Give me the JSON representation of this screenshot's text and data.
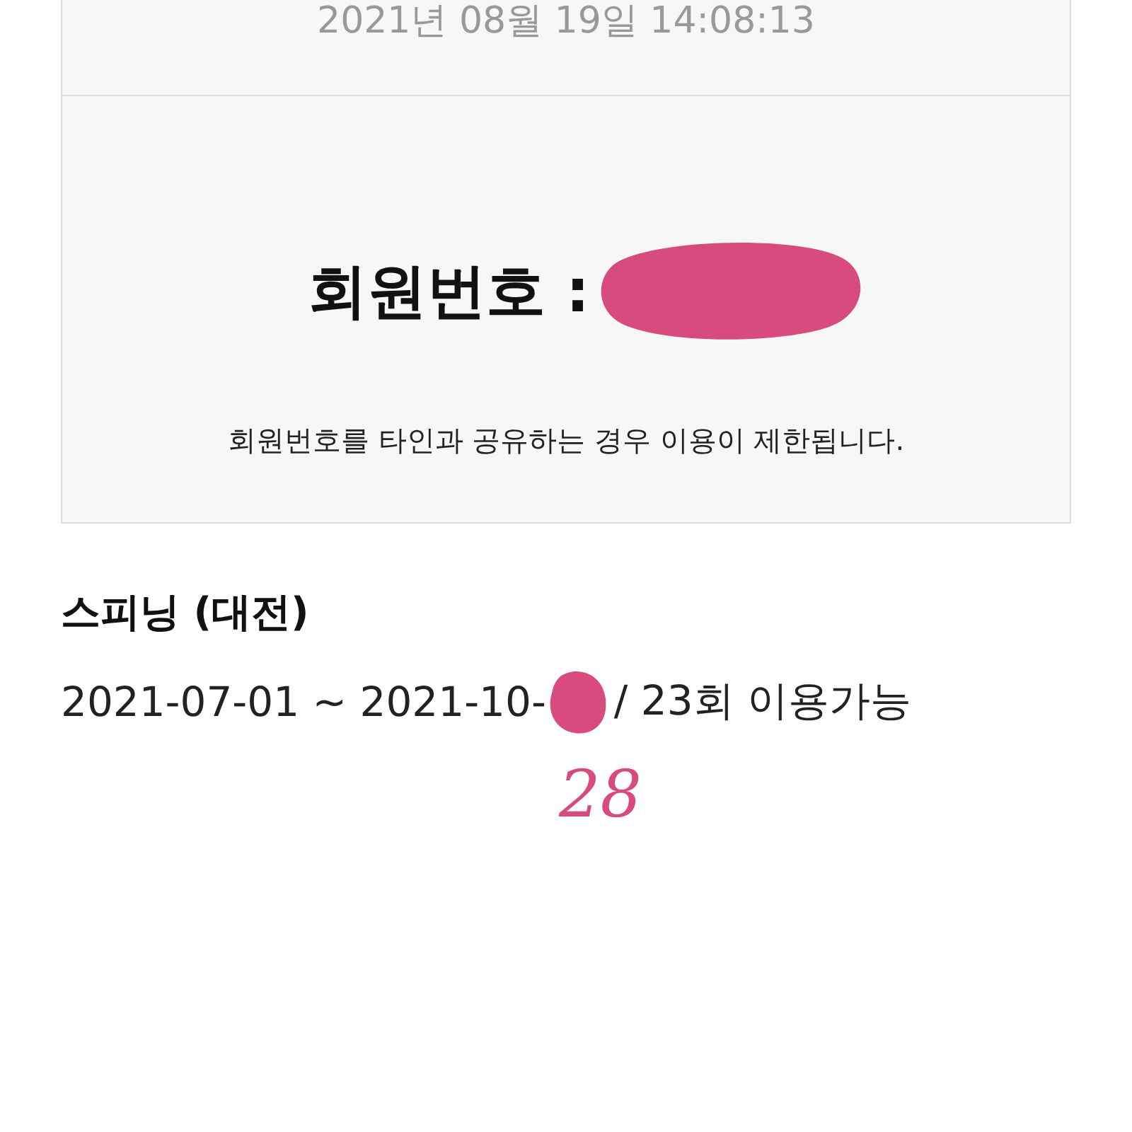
{
  "card": {
    "timestamp": "2021년 08월 19일 14:08:13",
    "member_label": "회원번호 :",
    "notice": "회원번호를 타인과 공유하는 경우 이용이 제한됩니다."
  },
  "pass": {
    "title": "스피닝 (대전)",
    "period": "2021-07-01 ~ 2021-10-",
    "usage": "/  23회 이용가능"
  },
  "annotation": "28"
}
